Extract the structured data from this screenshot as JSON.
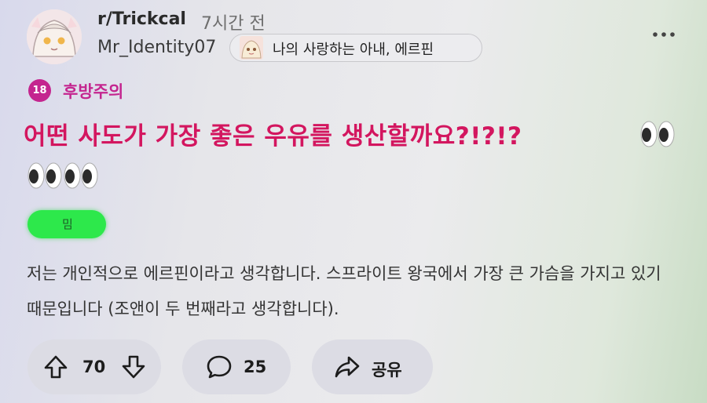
{
  "post": {
    "community": "r/Trickcal",
    "time_ago": "7시간 전",
    "author": "Mr_Identity07",
    "author_flair": "나의 사랑하는 아내, 에르핀",
    "nsfw_badge": "18",
    "nsfw_label": "후방주의",
    "title": "어떤 사도가 가장 좋은 우유를 생산할까요?!?!?",
    "post_flair": "밈",
    "body": "저는 개인적으로 에르핀이라고 생각합니다. 스프라이트 왕국에서 가장 큰 가슴을 가지고 있기 때문입니다 (조앤이 두 번째라고 생각합니다)."
  },
  "actions": {
    "votes": "70",
    "comments": "25",
    "share_label": "공유"
  },
  "icons": {
    "more": "more-horizontal-icon",
    "upvote": "arrow-up-icon",
    "downvote": "arrow-down-icon",
    "comment": "chat-bubble-icon",
    "share": "share-arrow-icon",
    "eyes": "eyes-emoji-icon"
  },
  "colors": {
    "title": "#d3165f",
    "nsfw": "#c4258f",
    "flair_green": "#2de84b",
    "pill_bg": "#dcdce4"
  }
}
